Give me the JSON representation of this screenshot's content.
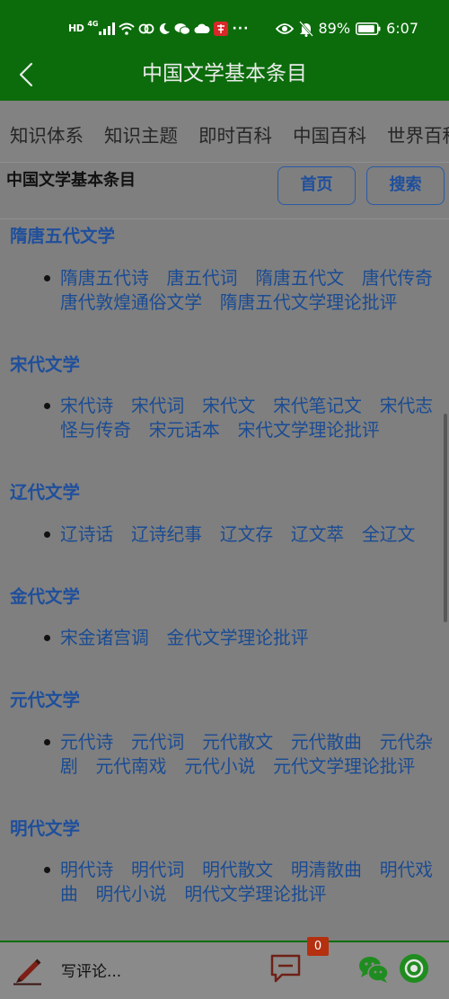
{
  "status_bar": {
    "hd_label": "HD",
    "network_label": "4G",
    "more_label": "···",
    "battery_percent": "89%",
    "battery_level": 0.89,
    "time": "6:07",
    "icons": [
      "signal-icon",
      "wifi-icon",
      "link-icon",
      "moon-icon",
      "wechat-icon",
      "cloud-icon",
      "app-icon",
      "eye-icon",
      "bell-off-icon",
      "battery-icon"
    ]
  },
  "header": {
    "title": "中国文学基本条目",
    "back_icon": "chevron-left-icon"
  },
  "tabs": [
    "知识体系",
    "知识主题",
    "即时百科",
    "中国百科",
    "世界百科"
  ],
  "title_row": {
    "title": "中国文学基本条目",
    "home_label": "首页",
    "search_label": "搜索"
  },
  "sections": [
    {
      "title": "隋唐五代文学",
      "items": [
        "隋唐五代诗",
        "唐五代词",
        "隋唐五代文",
        "唐代传奇",
        "唐代敦煌通俗文学",
        "隋唐五代文学理论批评"
      ]
    },
    {
      "title": "宋代文学",
      "items": [
        "宋代诗",
        "宋代词",
        "宋代文",
        "宋代笔记文",
        "宋代志怪与传奇",
        "宋元话本",
        "宋代文学理论批评"
      ]
    },
    {
      "title": "辽代文学",
      "items": [
        "辽诗话",
        "辽诗纪事",
        "辽文存",
        "辽文萃",
        "全辽文"
      ]
    },
    {
      "title": "金代文学",
      "items": [
        "宋金诸宫调",
        "金代文学理论批评"
      ]
    },
    {
      "title": "元代文学",
      "items": [
        "元代诗",
        "元代词",
        "元代散文",
        "元代散曲",
        "元代杂剧",
        "元代南戏",
        "元代小说",
        "元代文学理论批评"
      ]
    },
    {
      "title": "明代文学",
      "items": [
        "明代诗",
        "明代词",
        "明代散文",
        "明清散曲",
        "明代戏曲",
        "明代小说",
        "明代文学理论批评"
      ]
    }
  ],
  "bottom_bar": {
    "comment_placeholder": "写评论...",
    "comment_count": "0",
    "icons": [
      "pen-icon",
      "comment-icon",
      "wechat-share-icon",
      "moments-share-icon"
    ]
  },
  "colors": {
    "brand_green": "#0c6c0c",
    "heading_blue": "#1f4f9c",
    "link_blue": "#1a4b93",
    "badge_red": "#b5300f"
  }
}
